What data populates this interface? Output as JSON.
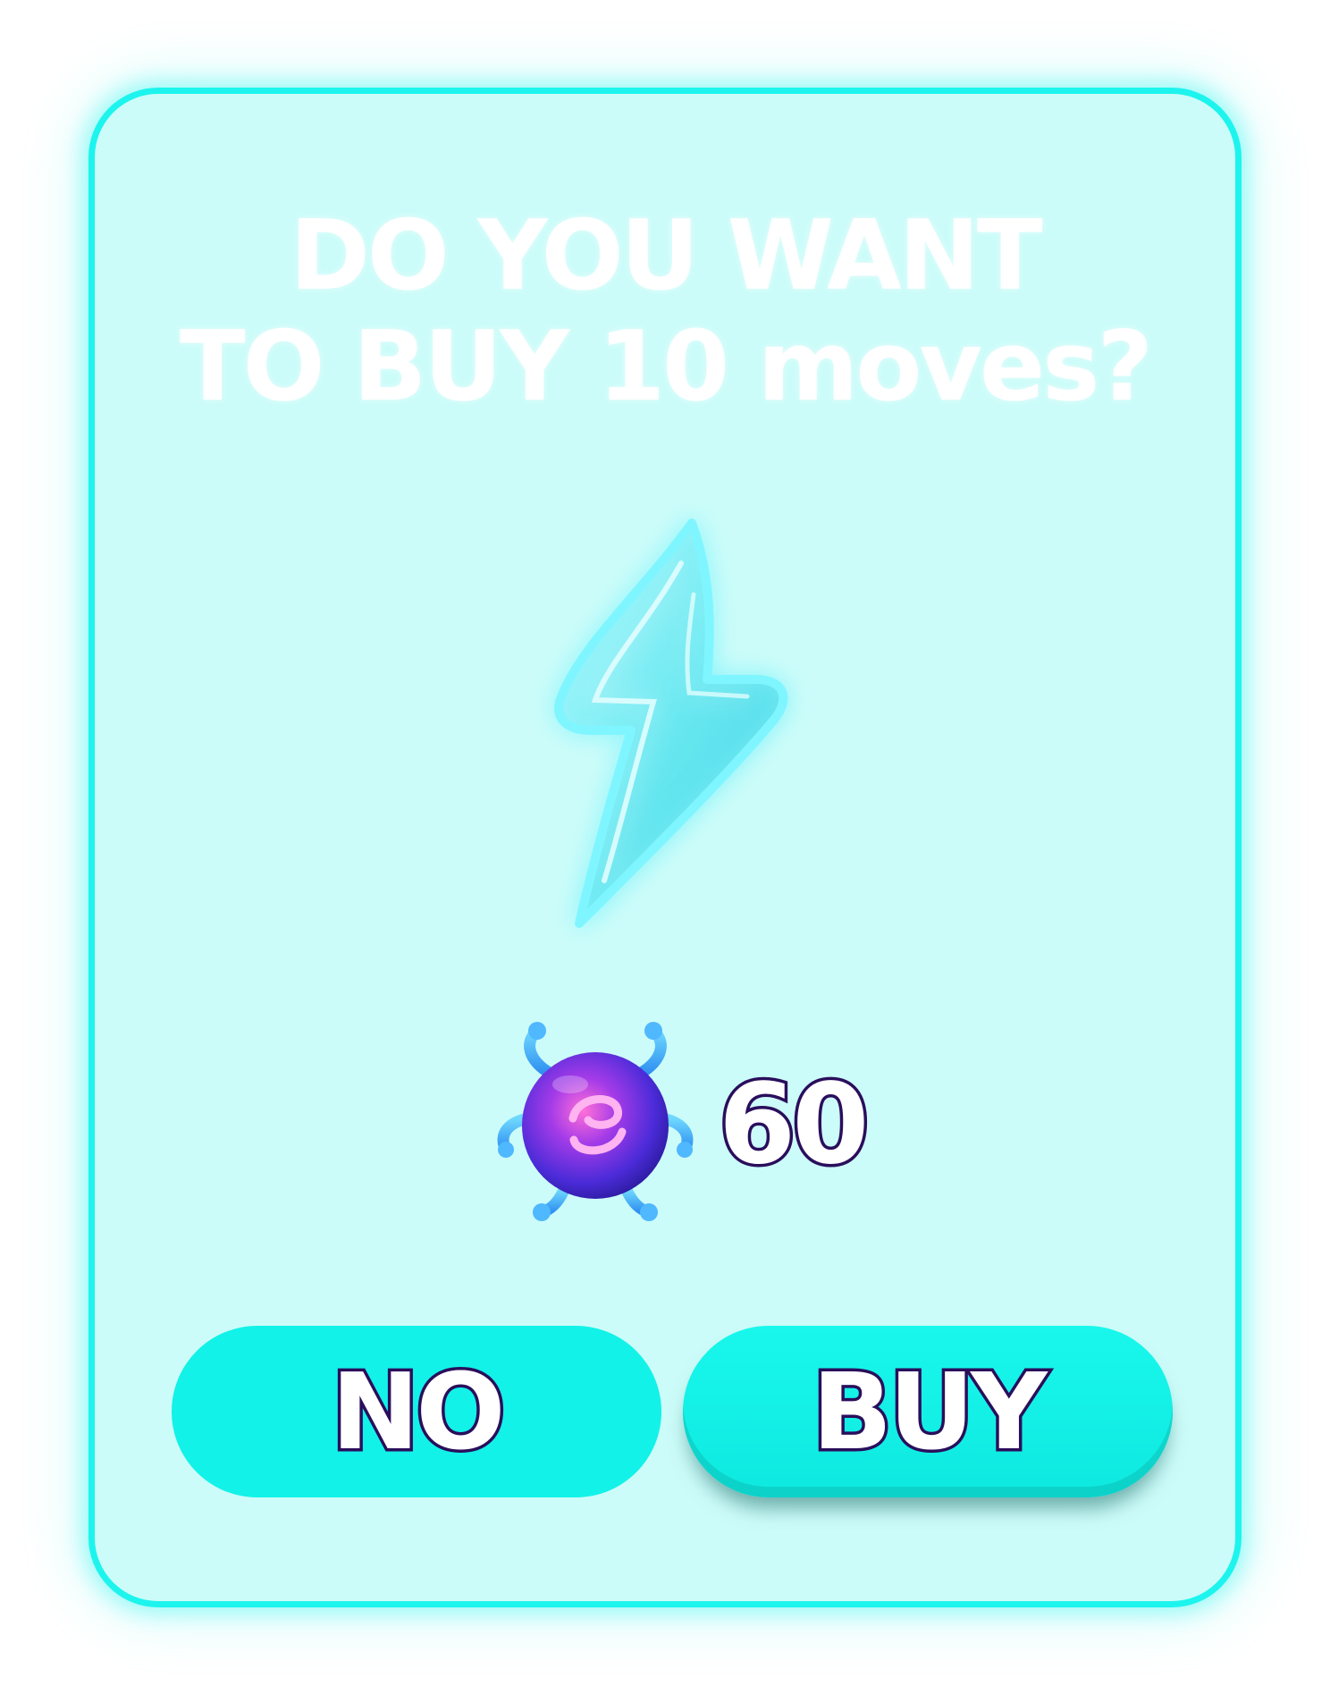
{
  "dialog": {
    "title_line_1": "DO YOU WANT",
    "title_line_2": "TO BUY 10 moves?",
    "item_icon": "lightning-bolt-icon",
    "price": {
      "currency_icon": "purple-gem-creature-icon",
      "amount": "60"
    },
    "buttons": {
      "no_label": "NO",
      "buy_label": "BUY"
    }
  },
  "colors": {
    "panel_bg": "#ccfcf9",
    "panel_border": "#1df4ee",
    "button": "#12f2e8",
    "text_outline": "#2a0e5c",
    "gem": "#6a2bd9"
  }
}
